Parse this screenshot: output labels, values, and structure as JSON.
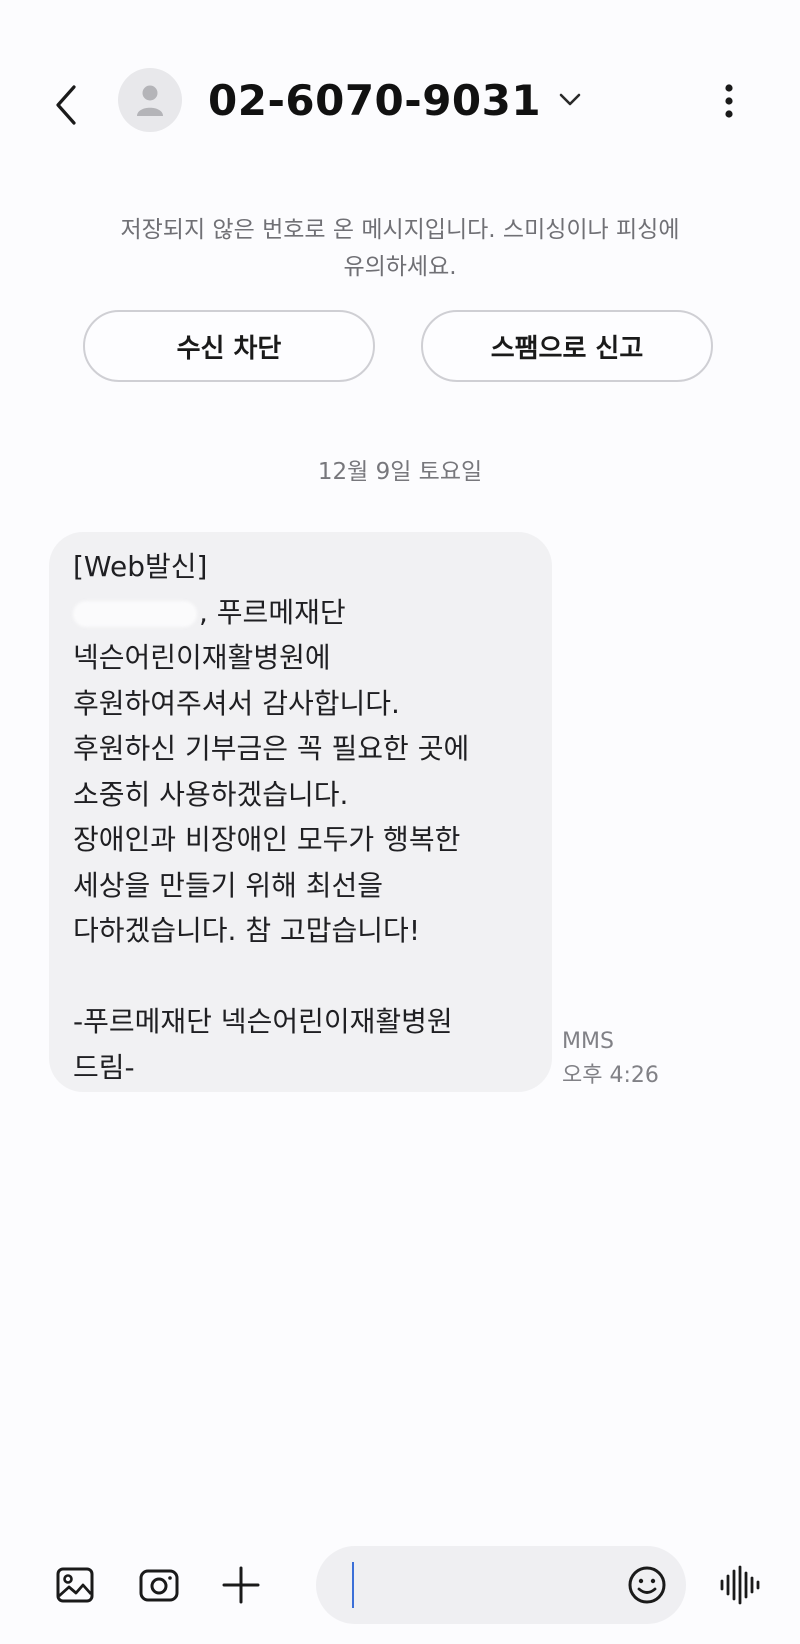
{
  "header": {
    "contact_number": "02-6070-9031"
  },
  "warning": {
    "line1": "저장되지 않은 번호로 온 메시지입니다. 스미싱이나 피싱에",
    "line2": "유의하세요."
  },
  "actions": {
    "block_label": "수신 차단",
    "spam_label": "스팸으로 신고"
  },
  "conversation": {
    "date": "12월 9일 토요일",
    "message": {
      "lines": [
        "[Web발신]",
        ", 푸르메재단",
        "넥슨어린이재활병원에",
        "후원하여주셔서 감사합니다.",
        "후원하신 기부금은 꼭 필요한 곳에",
        "소중히 사용하겠습니다.",
        "장애인과 비장애인 모두가 행복한",
        "세상을 만들기 위해 최선을",
        "다하겠습니다. 참 고맙습니다!",
        "",
        "-푸르메재단 넥슨어린이재활병원",
        "드림-"
      ],
      "type": "MMS",
      "time": "오후 4:26"
    }
  },
  "composer": {
    "input_value": "",
    "icons": [
      "gallery-icon",
      "camera-icon",
      "plus-icon",
      "emoji-icon",
      "voice-icon"
    ]
  },
  "colors": {
    "background": "#fcfcfe",
    "bubble": "#f1f1f3",
    "caret": "#3b6fd8"
  }
}
